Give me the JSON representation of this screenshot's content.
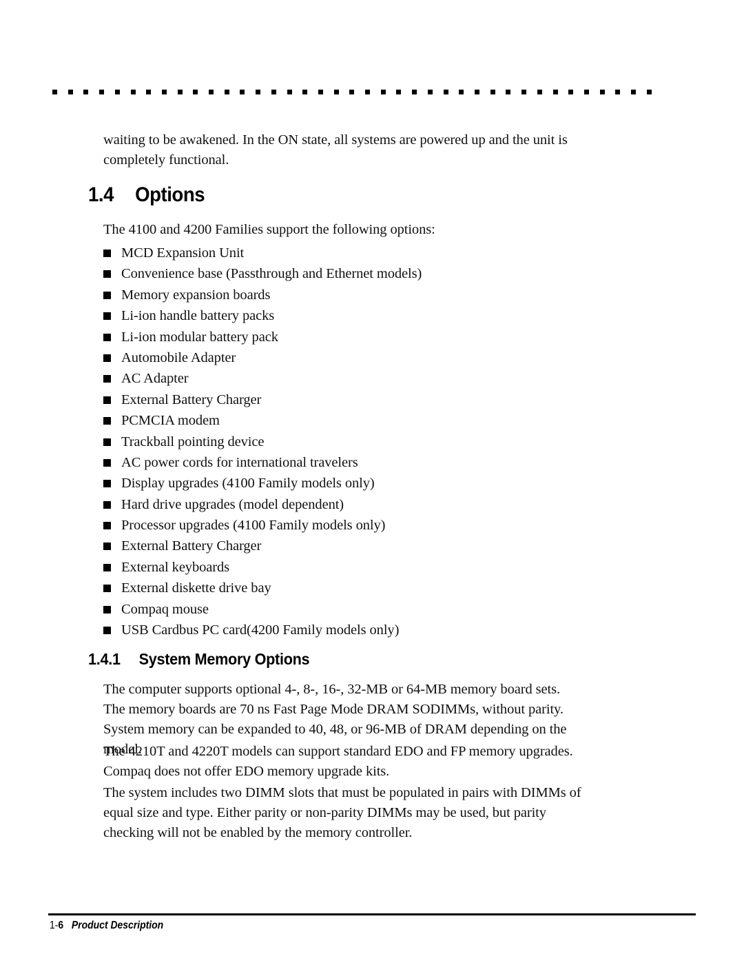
{
  "page": {
    "header_rule": {
      "icon": "dotted-rule",
      "dot_count": 39
    }
  },
  "intro_paragraph": "waiting to be awakened. In the ON state, all systems are powered up and the unit is completely functional.",
  "section": {
    "number": "1.4",
    "title": "Options",
    "lead_in": "The 4100 and 4200 Families support the following options:",
    "options": [
      "MCD Expansion Unit",
      "Convenience base (Passthrough and Ethernet models)",
      "Memory expansion boards",
      "Li-ion handle battery packs",
      "Li-ion modular battery pack",
      "Automobile Adapter",
      "AC Adapter",
      "External Battery Charger",
      "PCMCIA modem",
      "Trackball pointing device",
      "AC power cords for international travelers",
      "Display upgrades (4100 Family models only)",
      "Hard drive upgrades (model dependent)",
      "Processor upgrades (4100 Family models only)",
      "External Battery Charger",
      "External keyboards",
      "External diskette drive bay",
      "Compaq mouse",
      "USB Cardbus PC card(4200 Family models only)"
    ]
  },
  "subsection": {
    "number": "1.4.1",
    "title": "System Memory Options",
    "paragraphs": [
      "The computer supports optional 4-, 8-, 16-, 32-MB or 64-MB memory board sets. The memory boards are 70 ns Fast Page Mode DRAM SODIMMs, without parity. System memory can be expanded to 40, 48, or 96-MB of DRAM depending on the model.",
      "The 4210T and 4220T models can support standard EDO and FP memory upgrades. Compaq does not offer EDO memory upgrade kits.",
      "The system includes two DIMM slots that must be populated in pairs with DIMMs of equal size and type. Either parity or non-parity DIMMs may be used, but parity checking will not be enabled by the memory controller."
    ]
  },
  "footer": {
    "page_prefix": "1-",
    "page_number": "6",
    "chapter_title": "Product Description"
  },
  "colors": {
    "text": "#111111",
    "rule": "#000000",
    "background": "#ffffff"
  }
}
